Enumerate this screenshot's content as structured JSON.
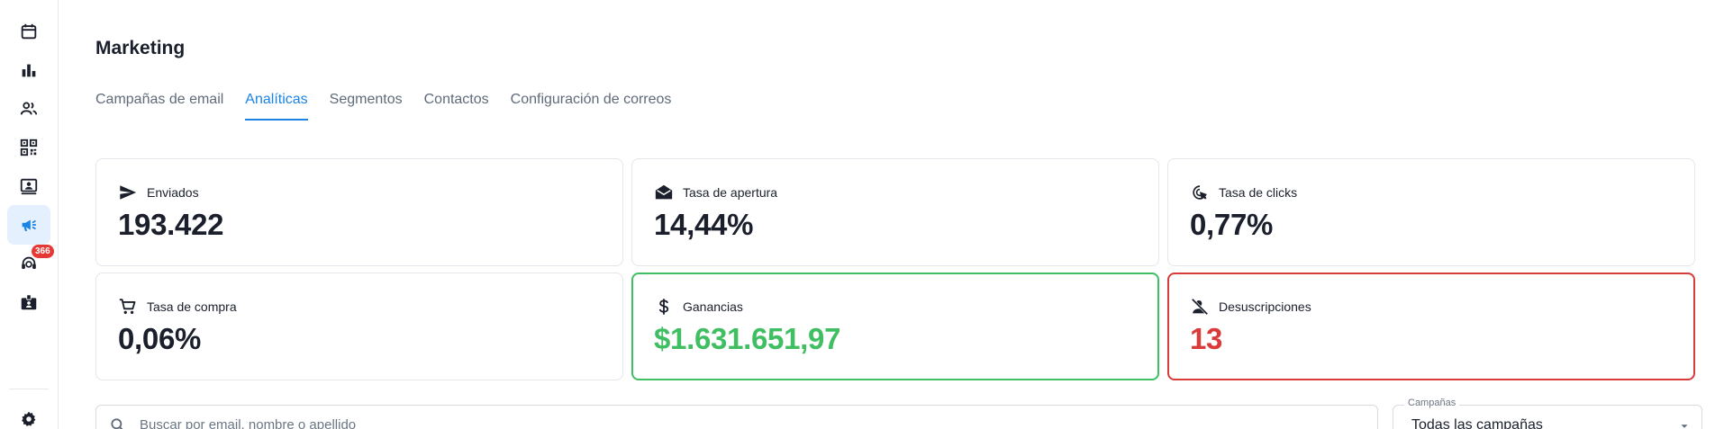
{
  "sidebar": {
    "items": [
      {
        "icon": "calendar-icon"
      },
      {
        "icon": "bar-chart-icon"
      },
      {
        "icon": "people-icon"
      },
      {
        "icon": "qr-code-icon"
      },
      {
        "icon": "contact-card-icon"
      },
      {
        "icon": "megaphone-icon",
        "active": true
      },
      {
        "icon": "support-agent-icon",
        "badge": "366"
      },
      {
        "icon": "badge-icon"
      },
      {
        "icon": "gear-icon"
      }
    ],
    "badge_count": "366"
  },
  "page": {
    "title": "Marketing"
  },
  "tabs": [
    {
      "label": "Campañas de email"
    },
    {
      "label": "Analíticas",
      "active": true
    },
    {
      "label": "Segmentos"
    },
    {
      "label": "Contactos"
    },
    {
      "label": "Configuración de correos"
    }
  ],
  "stats": {
    "sent": {
      "label": "Enviados",
      "value": "193.422",
      "icon": "send-icon"
    },
    "open_rate": {
      "label": "Tasa de apertura",
      "value": "14,44%",
      "icon": "open-mail-icon"
    },
    "click_rate": {
      "label": "Tasa de clicks",
      "value": "0,77%",
      "icon": "cursor-click-icon"
    },
    "purchase_rate": {
      "label": "Tasa de compra",
      "value": "0,06%",
      "icon": "cart-icon"
    },
    "earnings": {
      "label": "Ganancias",
      "value": "$1.631.651,97",
      "icon": "dollar-icon",
      "color": "#3fbe62"
    },
    "unsubscribes": {
      "label": "Desuscripciones",
      "value": "13",
      "icon": "person-off-icon",
      "color": "#d93a3a"
    }
  },
  "filters": {
    "search_placeholder": "Buscar por email, nombre o apellido",
    "campaigns_label": "Campañas",
    "campaigns_value": "Todas las campañas"
  },
  "colors": {
    "accent": "#1a84e4",
    "success": "#3fbe62",
    "danger": "#d93a3a"
  }
}
